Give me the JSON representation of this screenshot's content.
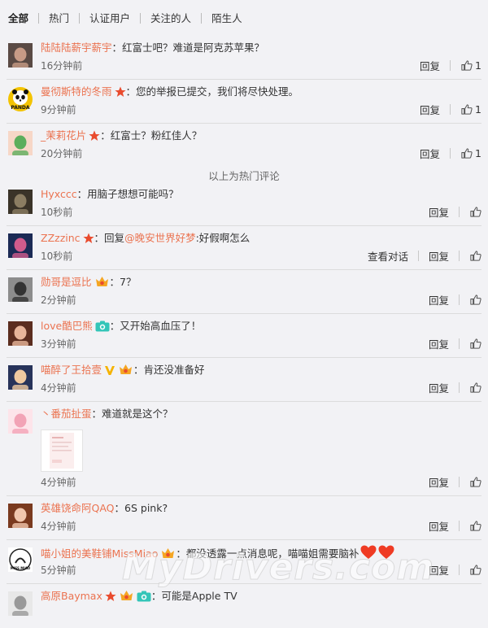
{
  "tabs": [
    "全部",
    "热门",
    "认证用户",
    "关注的人",
    "陌生人"
  ],
  "labels": {
    "reply": "回复",
    "view_dialog": "查看对话",
    "hot_divider": "以上为热门评论"
  },
  "hot_comments": [
    {
      "user": "陆陆陆薪宇薪宇",
      "text": "红富士吧？难道是阿克苏苹果？",
      "time": "16分钟前",
      "likes": "1",
      "avatar": "avatar-girl"
    },
    {
      "user": "曼彻斯特的冬雨",
      "text": "您的举报已提交，我们将尽快处理。",
      "time": "9分钟前",
      "likes": "1",
      "avatar": "panda-avatar",
      "badges": [
        "star-icon"
      ],
      "avatar_text": "PANDA"
    },
    {
      "user": "_茉莉花片",
      "text": "红富士？粉红佳人？",
      "time": "20分钟前",
      "likes": "1",
      "avatar": "cartoon-avatar",
      "badges": [
        "star-icon"
      ]
    }
  ],
  "comments": [
    {
      "user": "Hyxccc",
      "text": "用脑子想想可能吗？",
      "time": "10秒前",
      "avatar": "avatar-dark"
    },
    {
      "user": "ZZzzinc",
      "text_prefix": "回复",
      "mention": "@晚安世界好梦",
      "text": ":好假啊怎么",
      "time": "10秒前",
      "avatar": "avatar-blue",
      "badges": [
        "star-icon"
      ],
      "view_dialog": true
    },
    {
      "user": "勋哥是逗比",
      "text": "7？",
      "time": "2分钟前",
      "avatar": "avatar-gray",
      "badges": [
        "vip-icon"
      ]
    },
    {
      "user": "love酷巴熊",
      "text": "又开始高血压了！",
      "time": "3分钟前",
      "avatar": "avatar-face",
      "badges": [
        "camera-icon"
      ]
    },
    {
      "user": "喵醉了王拾壹",
      "text": "肯还没准备好",
      "time": "4分钟前",
      "avatar": "avatar-cartoon-dark",
      "badges": [
        "verified-v-icon",
        "vip-icon"
      ]
    },
    {
      "user": "丶番茄扯蛋",
      "text": "难道就是这个？",
      "time": "4分钟前",
      "avatar": "avatar-pink",
      "has_image": true
    },
    {
      "user": "英雄饶命阿QAQ",
      "text": "6S pink?",
      "time": "4分钟前",
      "avatar": "avatar-child"
    },
    {
      "user": "喵小姐的美鞋铺MissMiao",
      "text": "都没透露一点消息呢，喵喵姐需要脑补",
      "time": "5分钟前",
      "avatar": "avatar-logo",
      "badges": [
        "vip-icon"
      ],
      "trailing": [
        "heart-icon",
        "heart-icon"
      ],
      "avatar_text": "MISS MIAO"
    },
    {
      "user": "高原Baymax",
      "text": "可能是Apple TV",
      "time": "",
      "avatar": "avatar-baymax",
      "badges": [
        "star-icon",
        "vip-icon",
        "camera-icon"
      ]
    }
  ],
  "watermark": "MyDrivers.com",
  "colors": {
    "username": "#eb7350",
    "background": "#f2f2f5",
    "divider": "#dcdcdc"
  }
}
